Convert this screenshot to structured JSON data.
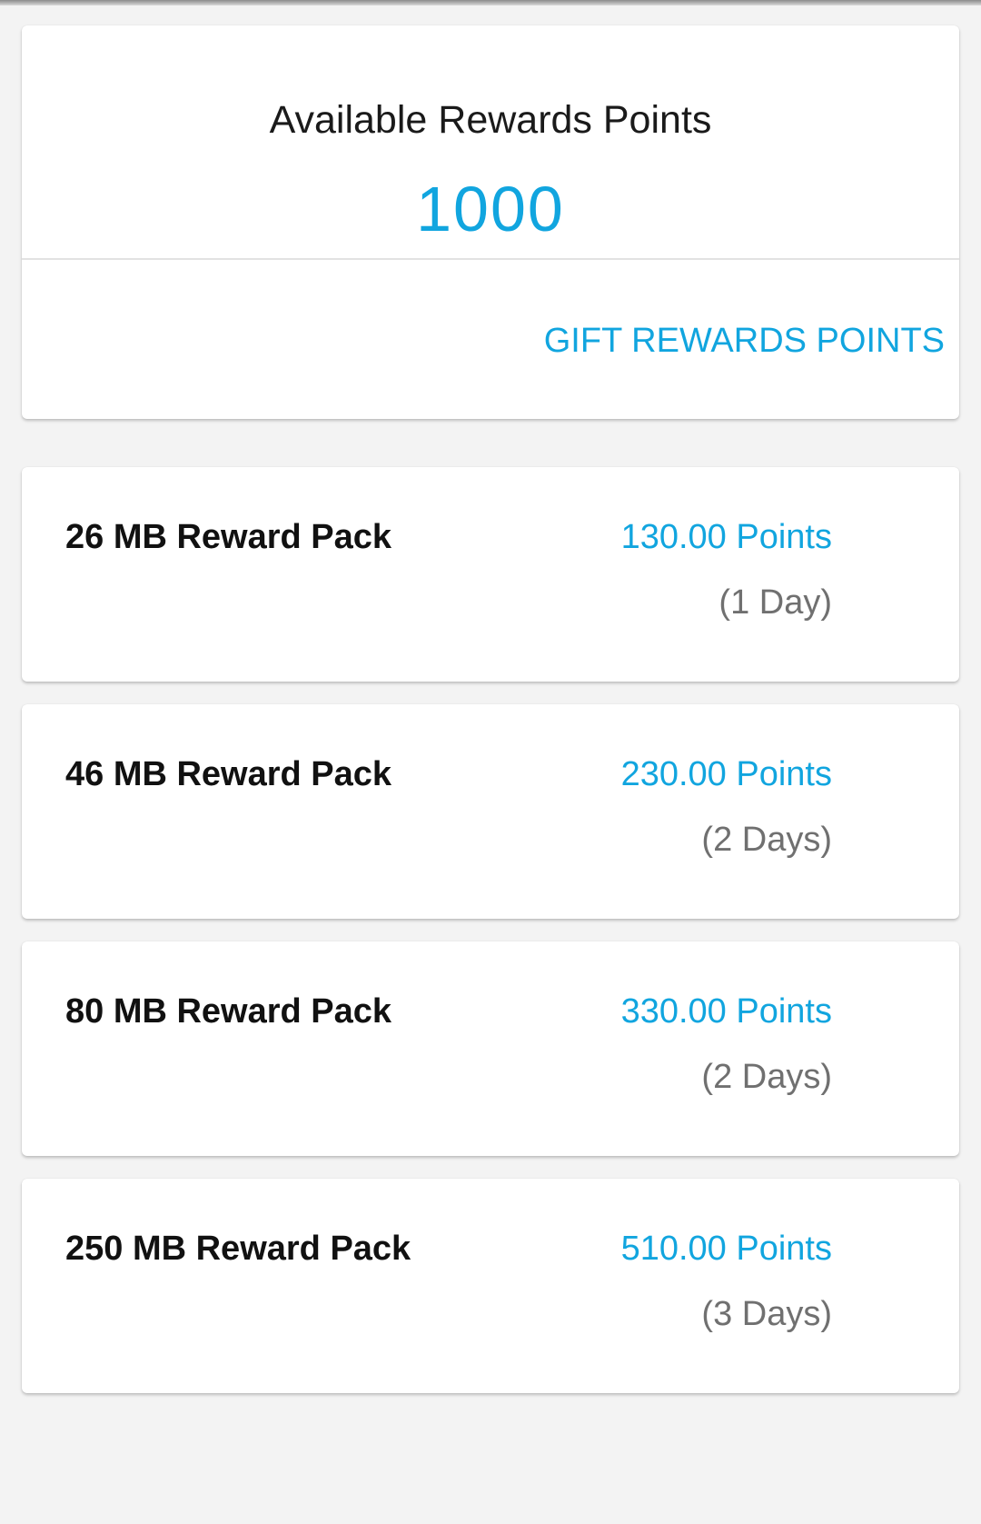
{
  "summary": {
    "title": "Available Rewards Points",
    "points": "1000",
    "gift_label": "GIFT REWARDS POINTS"
  },
  "packs": [
    {
      "name": "26 MB Reward Pack",
      "points": "130.00 Points",
      "duration": "(1 Day)"
    },
    {
      "name": "46 MB Reward Pack",
      "points": "230.00 Points",
      "duration": "(2 Days)"
    },
    {
      "name": "80 MB Reward Pack",
      "points": "330.00 Points",
      "duration": "(2 Days)"
    },
    {
      "name": "250 MB Reward Pack",
      "points": "510.00 Points",
      "duration": "(3 Days)"
    }
  ],
  "colors": {
    "accent": "#11a5df",
    "background": "#f3f3f3",
    "card": "#ffffff",
    "secondary_text": "#707070"
  }
}
